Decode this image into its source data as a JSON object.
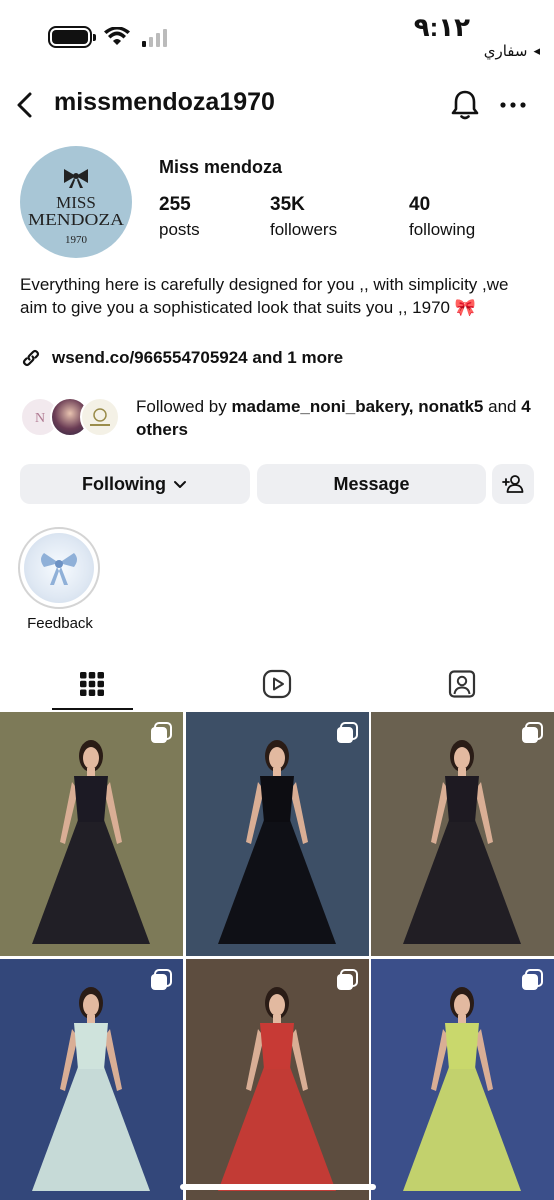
{
  "status_bar": {
    "time": "٩:١٢",
    "back_label": "سفاري",
    "back_arrow": "◂"
  },
  "header": {
    "username": "missmendoza1970"
  },
  "profile": {
    "display_name": "Miss mendoza",
    "logo_line1": "MISS",
    "logo_line2": "MENDOZA",
    "logo_year": "1970",
    "stats": [
      {
        "value": "255",
        "label": "posts"
      },
      {
        "value": "35K",
        "label": "followers"
      },
      {
        "value": "40",
        "label": "following"
      }
    ],
    "bio": "Everything here is carefully designed for you ,, with simplicity ,we aim to give you a sophisticated look that suits you ,, 1970 🎀",
    "link": "wsend.co/966554705924 and 1 more"
  },
  "followed_by": {
    "prefix": "Followed by ",
    "names": "madame_noni_bakery, nonatk5",
    "and": " and ",
    "others": "4 others"
  },
  "actions": {
    "following_label": "Following",
    "message_label": "Message"
  },
  "highlights": [
    {
      "label": "Feedback"
    }
  ],
  "tabs": [
    {
      "icon": "grid-icon"
    },
    {
      "icon": "reels-icon"
    },
    {
      "icon": "tagged-icon"
    }
  ],
  "posts": [
    {
      "icon": "multi-photo-icon",
      "backdrop": "#7d7a58",
      "dress": "#1c1a24"
    },
    {
      "icon": "multi-photo-icon",
      "backdrop": "#3d4f66",
      "dress": "#0d0d12"
    },
    {
      "icon": "multi-photo-icon",
      "backdrop": "#6a6150",
      "dress": "#1e1a22"
    },
    {
      "icon": "multi-photo-icon",
      "backdrop": "#33477a",
      "dress": "#cfe3dc"
    },
    {
      "icon": "multi-photo-icon",
      "backdrop": "#5d4d3f",
      "dress": "#c73a35"
    },
    {
      "icon": "multi-photo-icon",
      "backdrop": "#3b4f8a",
      "dress": "#c9d86c"
    }
  ]
}
